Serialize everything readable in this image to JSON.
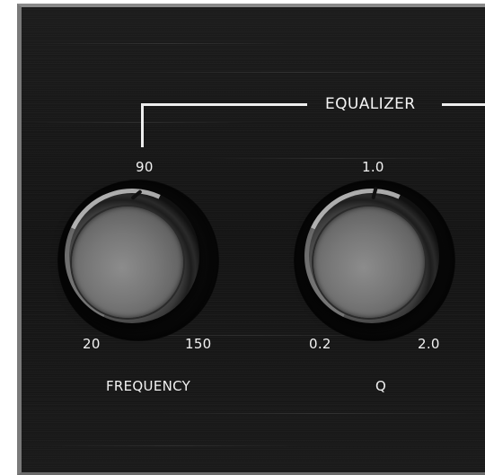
{
  "panel": {
    "section_title": "EQUALIZER",
    "frequency": {
      "label": "FREQUENCY",
      "scale_top": "90",
      "scale_min": "20",
      "scale_max": "150"
    },
    "q": {
      "label": "Q",
      "scale_top": "1.0",
      "scale_min": "0.2",
      "scale_max": "2.0"
    }
  },
  "colors": {
    "panel_background": "#181818",
    "label_text": "#f2f2f2",
    "frame_border": "#7a7a7a"
  }
}
